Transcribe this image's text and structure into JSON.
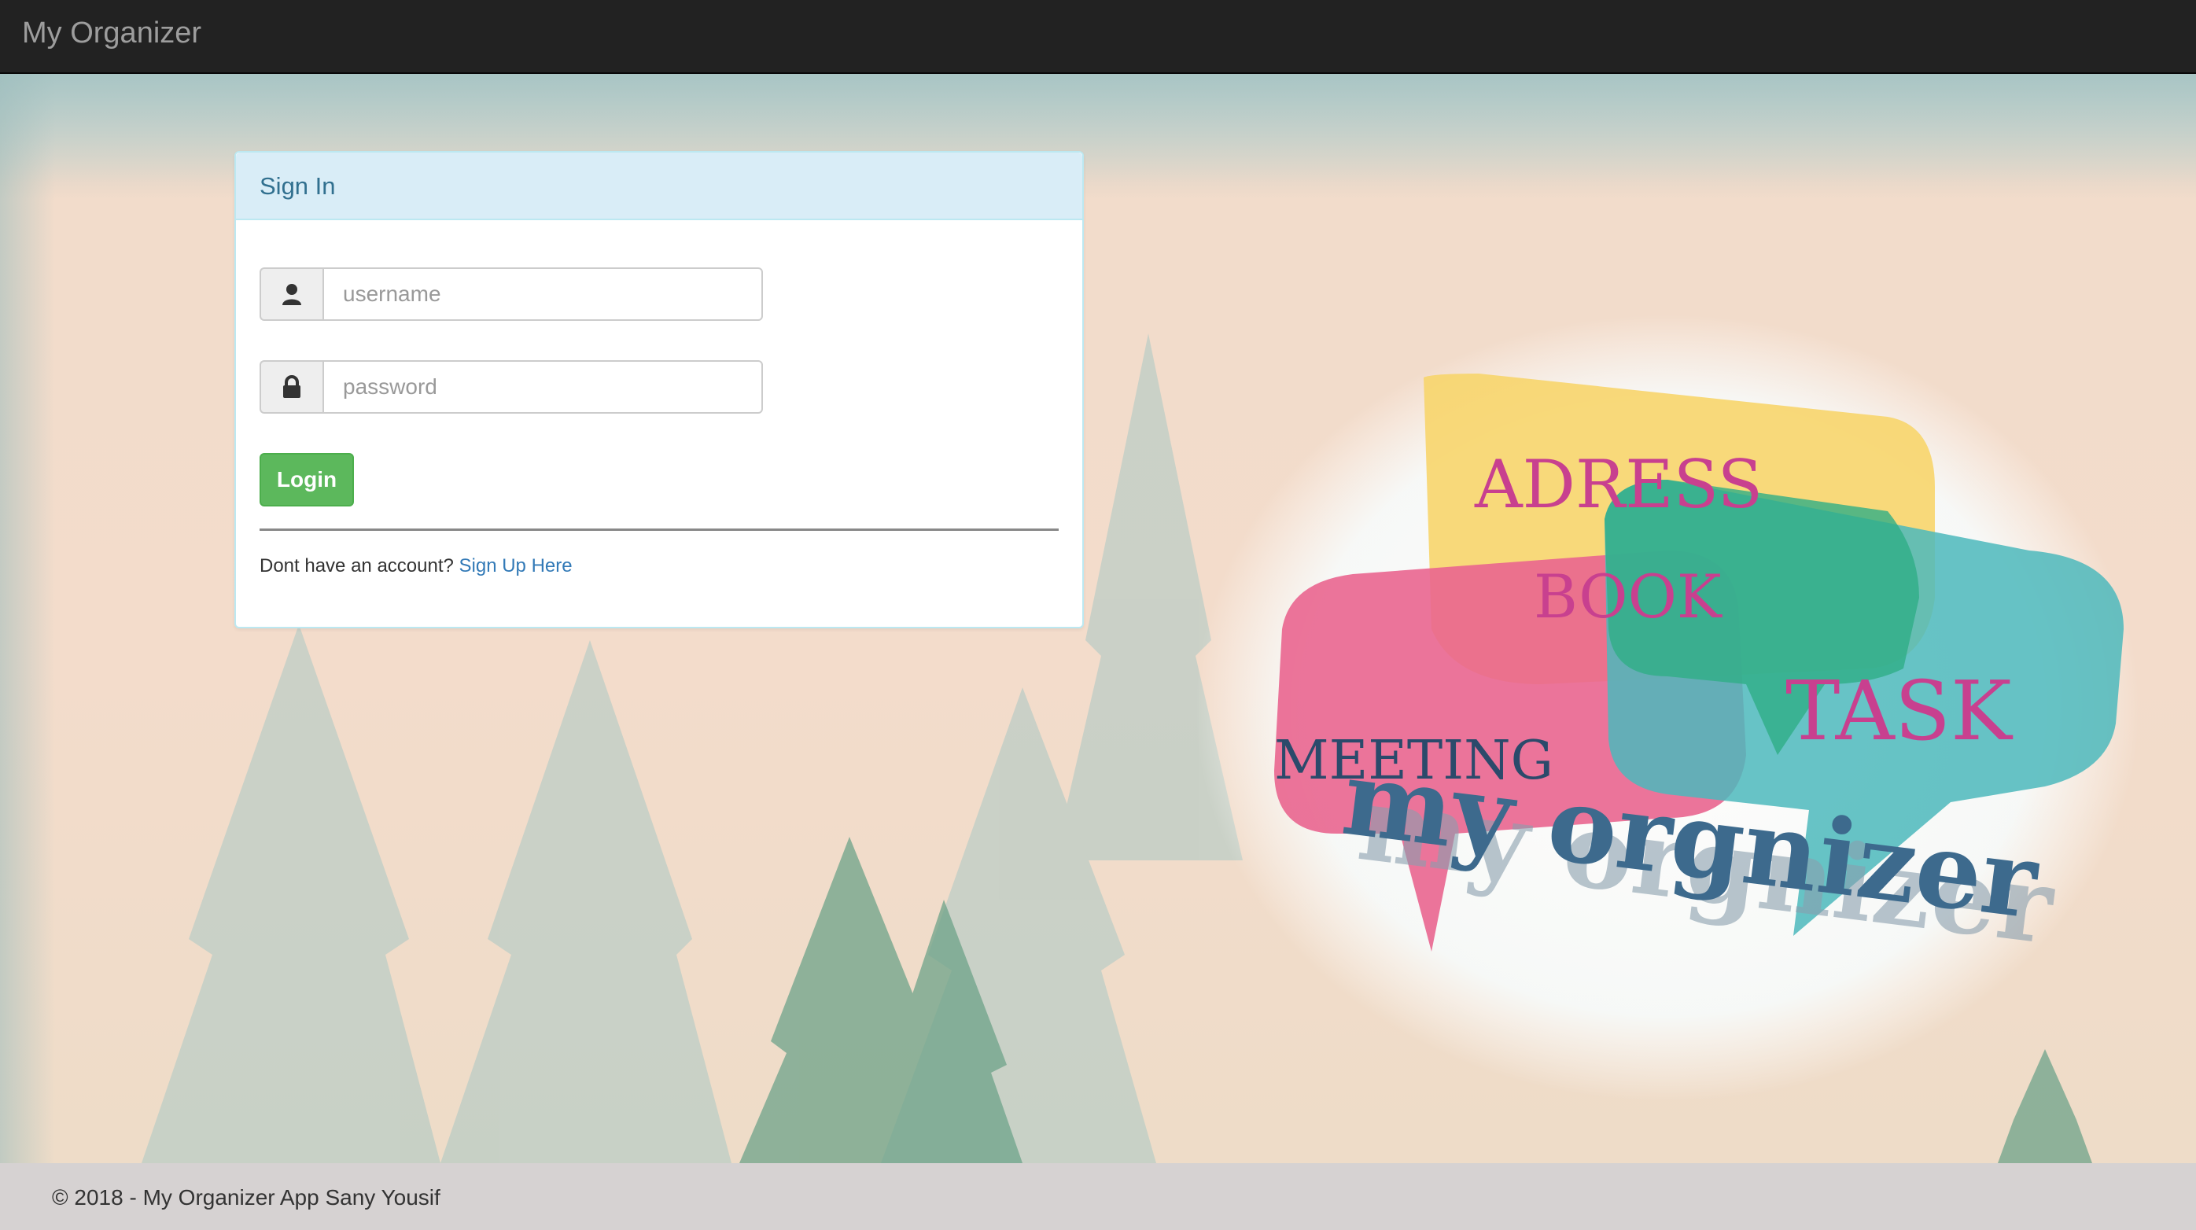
{
  "navbar": {
    "brand": "My Organizer"
  },
  "signin": {
    "title": "Sign In",
    "username_placeholder": "username",
    "password_placeholder": "password",
    "login_label": "Login",
    "no_account_text": "Dont have an account? ",
    "signup_link": "Sign Up Here"
  },
  "logo": {
    "word1": "ADRESS",
    "word2": "BOOK",
    "word3": "MEETING",
    "word4": "TASK",
    "wordmark": "my orgnizer",
    "colors": {
      "yellow": "#f7d56b",
      "pink": "#e9658f",
      "green": "#2fae86",
      "teal": "#4cb8bc",
      "text_pink": "#c8408f",
      "wordmark": "#3d6a8d"
    }
  },
  "footer": {
    "text": "© 2018 - My Organizer App Sany Yousif"
  },
  "colors": {
    "navbar": "#222222",
    "panel_heading": "#d9edf7",
    "login_button": "#5cb85c",
    "link": "#337ab7",
    "footer": "#d6d2d2"
  }
}
